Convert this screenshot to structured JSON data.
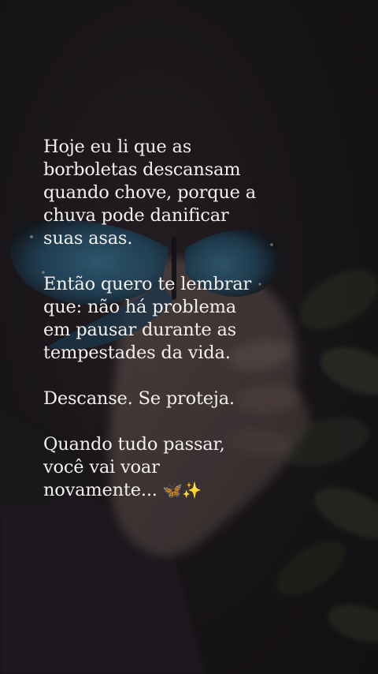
{
  "message": {
    "paragraphs": [
      {
        "lines": [
          "Hoje eu li que as",
          "borboletas descansam",
          "quando chove, porque a",
          "chuva pode danificar",
          "suas asas."
        ]
      },
      {
        "lines": [
          "Então quero te lembrar",
          "que: não há problema",
          "em pausar durante as",
          "tempestades da vida."
        ]
      },
      {
        "lines": [
          "Descanse. Se proteja."
        ]
      },
      {
        "lines": [
          "Quando tudo passar,",
          "você vai voar",
          "novamente..."
        ],
        "trailing_emoji": "🦋✨"
      }
    ]
  },
  "background": {
    "subject": "hand holding a blue butterfly",
    "colors": {
      "base": "#1c181c",
      "butterfly_blue": "#2f6f95",
      "skin": "#6e5a55",
      "sleeve": "#221e22",
      "foliage": "#2f3a2a",
      "text": "#f3f0ee"
    }
  }
}
